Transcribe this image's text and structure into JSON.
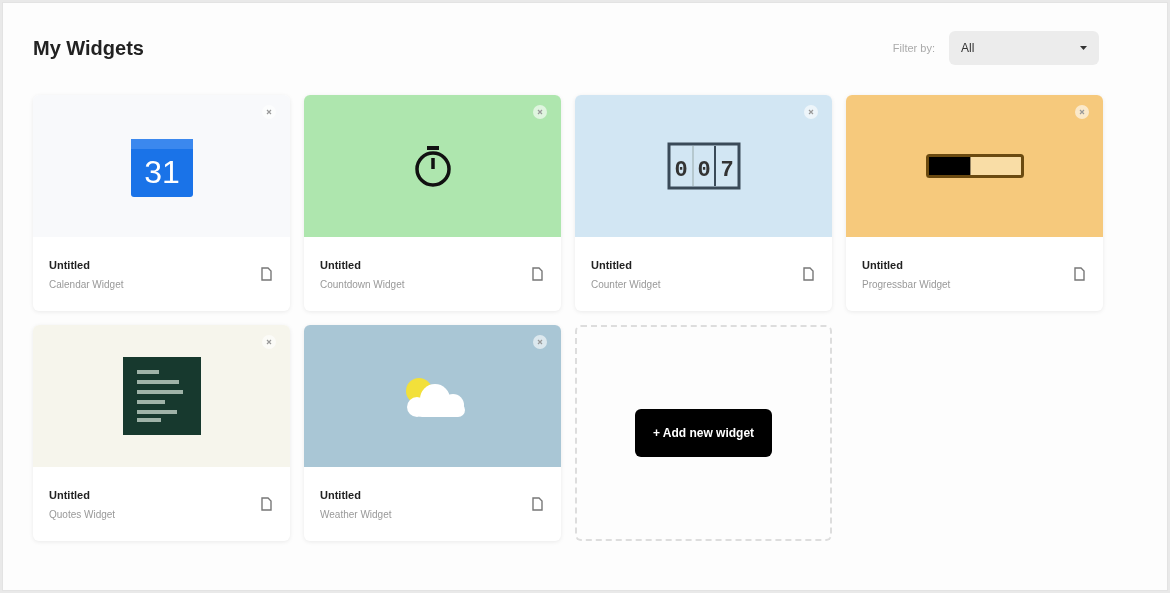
{
  "title": "My Widgets",
  "filter": {
    "label": "Filter by:",
    "value": "All"
  },
  "widgets": [
    {
      "kind": "calendar",
      "title": "Untitled",
      "subtitle": "Calendar Widget",
      "color": "#f8f9fb",
      "calendar_day": "31"
    },
    {
      "kind": "countdown",
      "title": "Untitled",
      "subtitle": "Countdown Widget",
      "color": "#aee6ae"
    },
    {
      "kind": "counter",
      "title": "Untitled",
      "subtitle": "Counter Widget",
      "color": "#d2e6f3",
      "digits": [
        "0",
        "0",
        "7"
      ]
    },
    {
      "kind": "progress",
      "title": "Untitled",
      "subtitle": "Progressbar Widget",
      "color": "#f6c97c",
      "level": 0.45
    },
    {
      "kind": "quotes",
      "title": "Untitled",
      "subtitle": "Quotes Widget",
      "color": "#f6f5ec"
    },
    {
      "kind": "weather",
      "title": "Untitled",
      "subtitle": "Weather Widget",
      "color": "#a9c6d5"
    }
  ],
  "add_button": "+ Add new widget"
}
